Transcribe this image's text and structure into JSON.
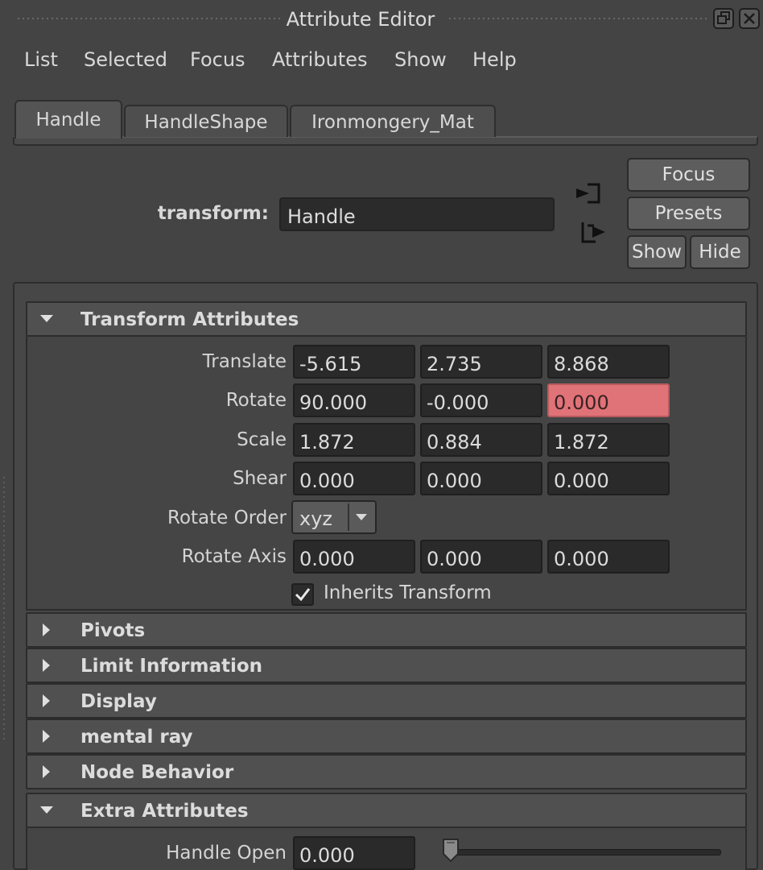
{
  "window": {
    "title": "Attribute Editor"
  },
  "menu": [
    "List",
    "Selected",
    "Focus",
    "Attributes",
    "Show",
    "Help"
  ],
  "tabs": [
    {
      "label": "Handle",
      "active": true
    },
    {
      "label": "HandleShape",
      "active": false
    },
    {
      "label": "Ironmongery_Mat",
      "active": false
    }
  ],
  "node": {
    "type_label": "transform:",
    "name": "Handle"
  },
  "buttons": {
    "focus": "Focus",
    "presets": "Presets",
    "show": "Show",
    "hide": "Hide"
  },
  "transform_attributes": {
    "title": "Transform Attributes",
    "expanded": true,
    "translate": {
      "label": "Translate",
      "values": [
        "-5.615",
        "2.735",
        "8.868"
      ]
    },
    "rotate": {
      "label": "Rotate",
      "values": [
        "90.000",
        "-0.000",
        "0.000"
      ],
      "keyed_index": 2
    },
    "scale": {
      "label": "Scale",
      "values": [
        "1.872",
        "0.884",
        "1.872"
      ]
    },
    "shear": {
      "label": "Shear",
      "values": [
        "0.000",
        "0.000",
        "0.000"
      ]
    },
    "rotate_order": {
      "label": "Rotate Order",
      "value": "xyz"
    },
    "rotate_axis": {
      "label": "Rotate Axis",
      "values": [
        "0.000",
        "0.000",
        "0.000"
      ]
    },
    "inherits_transform": {
      "label": "Inherits Transform",
      "checked": true
    }
  },
  "collapsed_sections": [
    "Pivots",
    "Limit Information",
    "Display",
    "mental ray",
    "Node Behavior"
  ],
  "extra_attributes": {
    "title": "Extra Attributes",
    "expanded": true,
    "handle_open": {
      "label": "Handle Open",
      "value": "0.000",
      "slider_fraction": 0.0
    }
  },
  "colors": {
    "background": "#444444",
    "field": "#2a2a2a",
    "keyed": "#e07378"
  }
}
